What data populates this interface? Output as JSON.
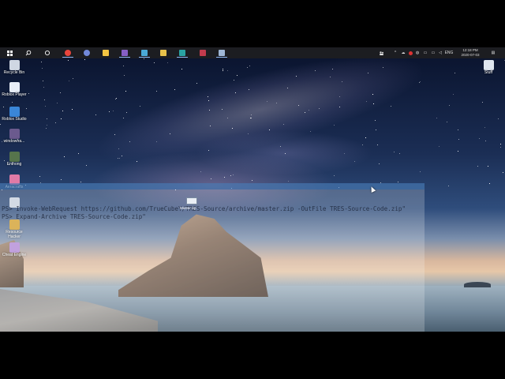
{
  "taskbar": {
    "apps": [
      {
        "name": "start-button",
        "color": "#ffffff"
      },
      {
        "name": "search-icon",
        "color": "#ffffff"
      },
      {
        "name": "cortana-icon",
        "color": "#ffffff"
      },
      {
        "name": "chrome-app",
        "color": "#e8453c"
      },
      {
        "name": "discord-app",
        "color": "#7289da"
      },
      {
        "name": "file-explorer-app",
        "color": "#f5c542"
      },
      {
        "name": "visual-studio-app",
        "color": "#865fc5"
      },
      {
        "name": "vs-code-app",
        "color": "#4aa8d6"
      },
      {
        "name": "store-app",
        "color": "#e8c14a"
      },
      {
        "name": "media-app",
        "color": "#2aa3a3"
      },
      {
        "name": "game-app",
        "color": "#c23b4d"
      },
      {
        "name": "powershell-app",
        "color": "#9fb7d6"
      }
    ],
    "tray_language": "ENG",
    "clock_time": "12:18 PM",
    "clock_date": "2020-07-03"
  },
  "desktop": {
    "icons_left": [
      {
        "label": "Recycle Bin",
        "color": "#cfd7e3"
      },
      {
        "label": "Roblox Player",
        "color": "#e8eef7"
      },
      {
        "label": "Roblox Studio",
        "color": "#3a86d8"
      },
      {
        "label": "windowfra...",
        "color": "#6b5a8e"
      },
      {
        "label": "Enthong",
        "color": "#56744c"
      },
      {
        "label": "Aeracrafts",
        "color": "#e07aa6"
      },
      {
        "label": "",
        "color": "#c9d3df"
      },
      {
        "label": "Resource Hacker",
        "color": "#d4a12f"
      },
      {
        "label": "Cheat Engine",
        "color": "#b38ad8"
      }
    ],
    "icon_right": {
      "label": "Stuff",
      "color": "#dfe6ef"
    },
    "window_small_label": "Master.zip"
  },
  "powershell": {
    "line1": "PS> Invoke-WebRequest https://github.com/TrueCubeY/TRES-Source/archive/master.zip -OutFile TRES-Source-Code.zip\"",
    "line2": "PS> Expand-Archive TRES-Source-Code.zip\""
  }
}
